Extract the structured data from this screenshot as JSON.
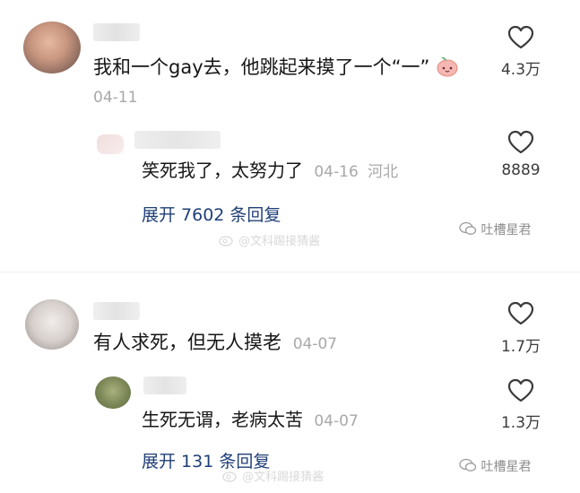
{
  "comments": [
    {
      "text": "我和一个gay去，他跳起来摸了一个“一”",
      "date": "04-11",
      "likes": "4.3万",
      "reply": {
        "text": "笑死我了，太努力了",
        "date": "04-16",
        "location": "河北",
        "likes": "8889"
      },
      "expand": "展开 7602 条回复"
    },
    {
      "text": "有人求死，但无人摸老",
      "date": "04-07",
      "likes": "1.7万",
      "reply": {
        "text": "生死无谓，老病太苦",
        "date": "04-07",
        "likes": "1.3万"
      },
      "expand": "展开 131 条回复"
    }
  ],
  "watermark": {
    "weibo": "@文科踢接猜酱",
    "right": "吐槽星君"
  }
}
